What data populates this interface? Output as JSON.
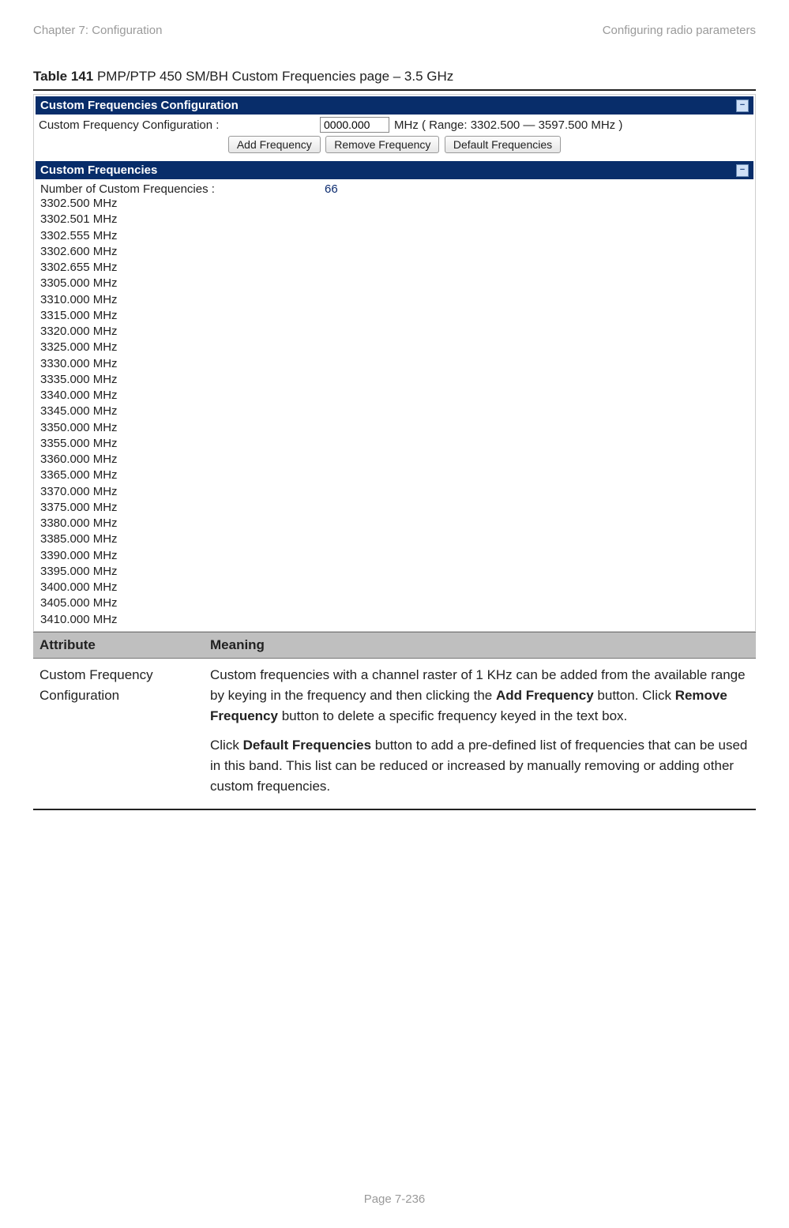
{
  "header": {
    "left": "Chapter 7:  Configuration",
    "right": "Configuring radio parameters"
  },
  "title": {
    "bold": "Table 141",
    "rest": " PMP/PTP 450 SM/BH Custom Frequencies page – 3.5 GHz"
  },
  "config_panel": {
    "title": "Custom Frequencies Configuration",
    "label": "Custom Frequency Configuration :",
    "input_value": "0000.000",
    "range_text": "MHz ( Range: 3302.500 — 3597.500 MHz )",
    "buttons": {
      "add": "Add Frequency",
      "remove": "Remove Frequency",
      "defaults": "Default Frequencies"
    }
  },
  "freq_panel": {
    "title": "Custom Frequencies",
    "count_label": "Number of Custom Frequencies :",
    "count_value": "66",
    "list": [
      "3302.500 MHz",
      "3302.501 MHz",
      "3302.555 MHz",
      "3302.600 MHz",
      "3302.655 MHz",
      "3305.000 MHz",
      "3310.000 MHz",
      "3315.000 MHz",
      "3320.000 MHz",
      "3325.000 MHz",
      "3330.000 MHz",
      "3335.000 MHz",
      "3340.000 MHz",
      "3345.000 MHz",
      "3350.000 MHz",
      "3355.000 MHz",
      "3360.000 MHz",
      "3365.000 MHz",
      "3370.000 MHz",
      "3375.000 MHz",
      "3380.000 MHz",
      "3385.000 MHz",
      "3390.000 MHz",
      "3395.000 MHz",
      "3400.000 MHz",
      "3405.000 MHz",
      "3410.000 MHz"
    ]
  },
  "table": {
    "head_attr": "Attribute",
    "head_meaning": "Meaning",
    "row1_attr": "Custom Frequency Configuration",
    "row1_p1_pre": "Custom frequencies with a channel raster of 1 KHz can be added from the available range by keying in the frequency and then clicking the ",
    "row1_p1_b1": "Add Frequency",
    "row1_p1_mid": " button. Click ",
    "row1_p1_b2": "Remove Frequency",
    "row1_p1_post": " button to delete a specific frequency keyed in the text box.",
    "row1_p2_pre": "Click ",
    "row1_p2_b": "Default Frequencies",
    "row1_p2_post": " button to add a pre-defined list of frequencies that can be used in this band. This list can be reduced or increased by manually removing or adding other custom frequencies."
  },
  "footer": "Page 7-236"
}
